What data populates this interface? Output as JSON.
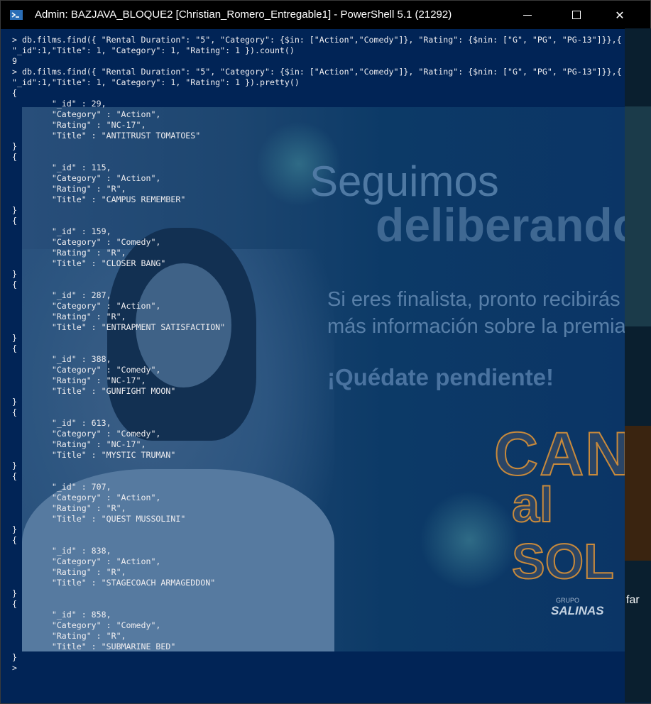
{
  "window": {
    "title": "Admin: BAZJAVA_BLOQUE2 [Christian_Romero_Entregable1] - PowerShell 5.1 (21292)",
    "controls": {
      "minimize": "–",
      "maximize": "□",
      "close": "✕"
    }
  },
  "console": {
    "lines": [
      "> db.films.find({ \"Rental Duration\": \"5\", \"Category\": {$in: [\"Action\",\"Comedy\"]}, \"Rating\": {$nin: [\"G\", \"PG\", \"PG-13\"]}},{",
      "\"_id\":1,\"Title\": 1, \"Category\": 1, \"Rating\": 1 }).count()",
      "9",
      "> db.films.find({ \"Rental Duration\": \"5\", \"Category\": {$in: [\"Action\",\"Comedy\"]}, \"Rating\": {$nin: [\"G\", \"PG\", \"PG-13\"]}},{",
      "\"_id\":1,\"Title\": 1, \"Category\": 1, \"Rating\": 1 }).pretty()",
      "{",
      "        \"_id\" : 29,",
      "        \"Category\" : \"Action\",",
      "        \"Rating\" : \"NC-17\",",
      "        \"Title\" : \"ANTITRUST TOMATOES\"",
      "}",
      "{",
      "        \"_id\" : 115,",
      "        \"Category\" : \"Action\",",
      "        \"Rating\" : \"R\",",
      "        \"Title\" : \"CAMPUS REMEMBER\"",
      "}",
      "{",
      "        \"_id\" : 159,",
      "        \"Category\" : \"Comedy\",",
      "        \"Rating\" : \"R\",",
      "        \"Title\" : \"CLOSER BANG\"",
      "}",
      "{",
      "        \"_id\" : 287,",
      "        \"Category\" : \"Action\",",
      "        \"Rating\" : \"R\",",
      "        \"Title\" : \"ENTRAPMENT SATISFACTION\"",
      "}",
      "{",
      "        \"_id\" : 388,",
      "        \"Category\" : \"Comedy\",",
      "        \"Rating\" : \"NC-17\",",
      "        \"Title\" : \"GUNFIGHT MOON\"",
      "}",
      "{",
      "        \"_id\" : 613,",
      "        \"Category\" : \"Comedy\",",
      "        \"Rating\" : \"NC-17\",",
      "        \"Title\" : \"MYSTIC TRUMAN\"",
      "}",
      "{",
      "        \"_id\" : 707,",
      "        \"Category\" : \"Action\",",
      "        \"Rating\" : \"R\",",
      "        \"Title\" : \"QUEST MUSSOLINI\"",
      "}",
      "{",
      "        \"_id\" : 838,",
      "        \"Category\" : \"Action\",",
      "        \"Rating\" : \"R\",",
      "        \"Title\" : \"STAGECOACH ARMAGEDDON\"",
      "}",
      "{",
      "        \"_id\" : 858,",
      "        \"Category\" : \"Comedy\",",
      "        \"Rating\" : \"R\",",
      "        \"Title\" : \"SUBMARINE BED\"",
      "}",
      ">"
    ]
  },
  "background_ad": {
    "headline1": "Seguimos",
    "headline2": "deliberando",
    "line1": "Si eres finalista, pronto recibirás",
    "line2": "más información sobre la premia",
    "line3": "¡Quédate pendiente!",
    "logo_line1": "CANTA",
    "logo_line2": "al SOL",
    "brand_small": "GRUPO",
    "brand": "SALINAS",
    "right_edge_text": "far"
  },
  "colors": {
    "console_bg": "#012456",
    "console_fg": "#eeedf0",
    "titlebar_bg": "#000000"
  },
  "icons": {
    "app": "powershell-icon",
    "scroll_up": "triangle-up",
    "scroll_down": "triangle-down"
  }
}
